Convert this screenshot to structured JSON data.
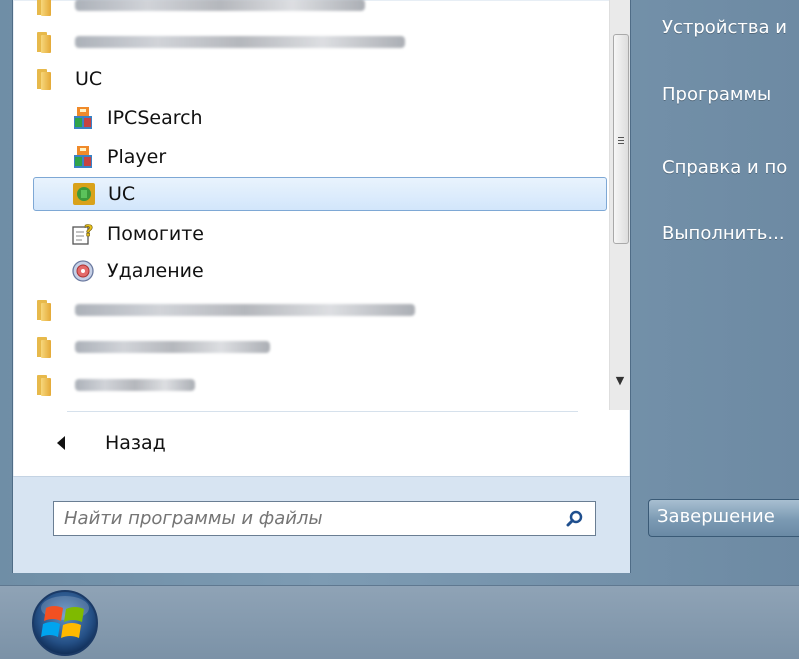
{
  "programs_list": {
    "items": [
      {
        "type": "folder",
        "label": "",
        "blurred": true
      },
      {
        "type": "folder",
        "label": "",
        "blurred": true
      },
      {
        "type": "folder",
        "label": "UC",
        "blurred": false
      },
      {
        "type": "app",
        "label": "IPCSearch",
        "icon": "ipcsearch-icon"
      },
      {
        "type": "app",
        "label": "Player",
        "icon": "player-icon"
      },
      {
        "type": "app",
        "label": "UC",
        "icon": "uc-app-icon",
        "selected": true
      },
      {
        "type": "app",
        "label": "Помогите",
        "icon": "help-icon"
      },
      {
        "type": "app",
        "label": "Удаление",
        "icon": "uninstall-icon"
      },
      {
        "type": "folder",
        "label": "",
        "blurred": true
      },
      {
        "type": "folder",
        "label": "",
        "blurred": true
      },
      {
        "type": "folder",
        "label": "",
        "blurred": true
      }
    ]
  },
  "back_label": "Назад",
  "search": {
    "placeholder": "Найти программы и файлы"
  },
  "right_panel": {
    "items": [
      "Устройства и",
      "Программы",
      "Справка и по",
      "Выполнить..."
    ],
    "shutdown_label": "Завершение"
  },
  "colors": {
    "selection": "#d2e6fb",
    "search_strip": "#d7e4f2",
    "taskbar": "#8fa3b6"
  }
}
